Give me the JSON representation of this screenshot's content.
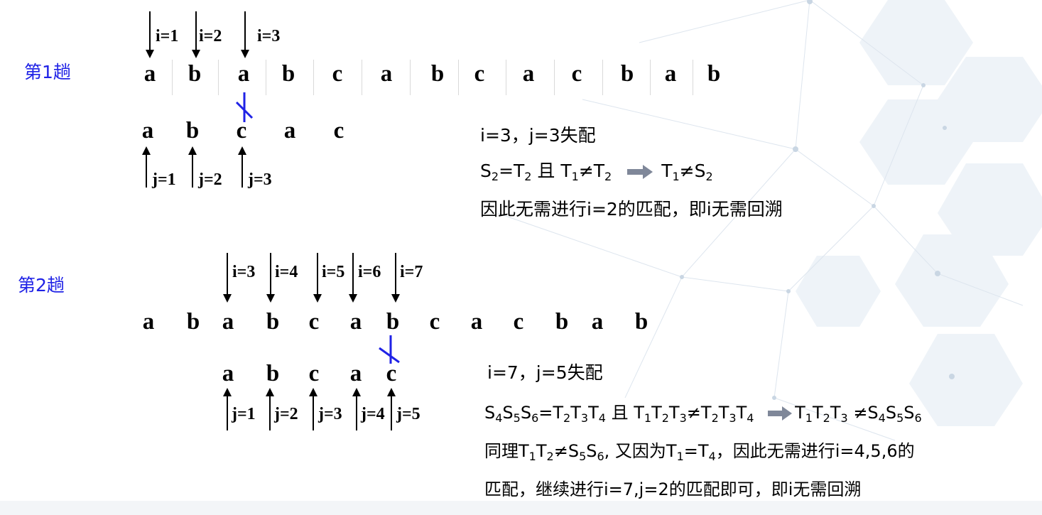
{
  "round1": {
    "label": "第1趟",
    "text": [
      "a",
      "b",
      "a",
      "b",
      "c",
      "a",
      "b",
      "c",
      "a",
      "c",
      "b",
      "a",
      "b"
    ],
    "pattern": [
      "a",
      "b",
      "c",
      "a",
      "c"
    ],
    "i_labels": [
      "i=1",
      "i=2",
      "i=3"
    ],
    "j_labels": [
      "j=1",
      "j=2",
      "j=3"
    ],
    "notes": {
      "line1": "i=3，j=3失配",
      "line2": {
        "S": "S",
        "s1": "2",
        "eq": "=T",
        "s2": "2",
        "and": " 且 T",
        "s3": "1",
        "neq": "≠T",
        "s4": "2",
        "r1": "T",
        "r1s": "1",
        "r2": "≠S",
        "r2s": "2"
      },
      "line3": "因此无需进行i=2的匹配，即i无需回溯"
    }
  },
  "round2": {
    "label": "第2趟",
    "text": [
      "a",
      "b",
      "a",
      "b",
      "c",
      "a",
      "b",
      "c",
      "a",
      "c",
      "b",
      "a",
      "b"
    ],
    "pattern": [
      "a",
      "b",
      "c",
      "a",
      "c"
    ],
    "i_labels": [
      "i=3",
      "i=4",
      "i=5",
      "i=6",
      "i=7"
    ],
    "j_labels": [
      "j=1",
      "j=2",
      "j=3",
      "j=4",
      "j=5"
    ],
    "notes": {
      "line1": "i=7，j=5失配",
      "line2": {
        "a": "S",
        "a1": "4",
        "b": "S",
        "b1": "5",
        "c": "S",
        "c1": "6",
        "eq": "=T",
        "d1": "2",
        "e": "T",
        "e1": "3",
        "f": "T",
        "f1": "4",
        "and": " 且 T",
        "g1": "1",
        "h": "T",
        "h1": "2",
        "k": "T",
        "k1": "3",
        "neq": "≠T",
        "m1": "2",
        "n": "T",
        "n1": "3",
        "o": "T",
        "o1": "4",
        "r": "T",
        "r1": "1",
        "s": "T",
        "s1": "2",
        "t": "T",
        "t1": "3",
        "u": " ≠S",
        "u1": "4",
        "v": "S",
        "v1": "5",
        "w": "S",
        "w1": "6"
      },
      "line3": {
        "p1": "同理T",
        "p1s": "1",
        "p2": "T",
        "p2s": "2",
        "p3": "≠S",
        "p3s": "5",
        "p4": "S",
        "p4s": "6",
        "p5": ", 又因为T",
        "p5s": "1",
        "p6": "=T",
        "p6s": "4",
        "p7": "，因此无需进行i=4,5,6的"
      },
      "line4": "匹配，继续进行i=7,j=2的匹配即可，即i无需回溯"
    }
  },
  "colors": {
    "label": "#1f22e6",
    "mismatch_mark": "#1f22e6",
    "implies_arrow": "#7f8799"
  }
}
